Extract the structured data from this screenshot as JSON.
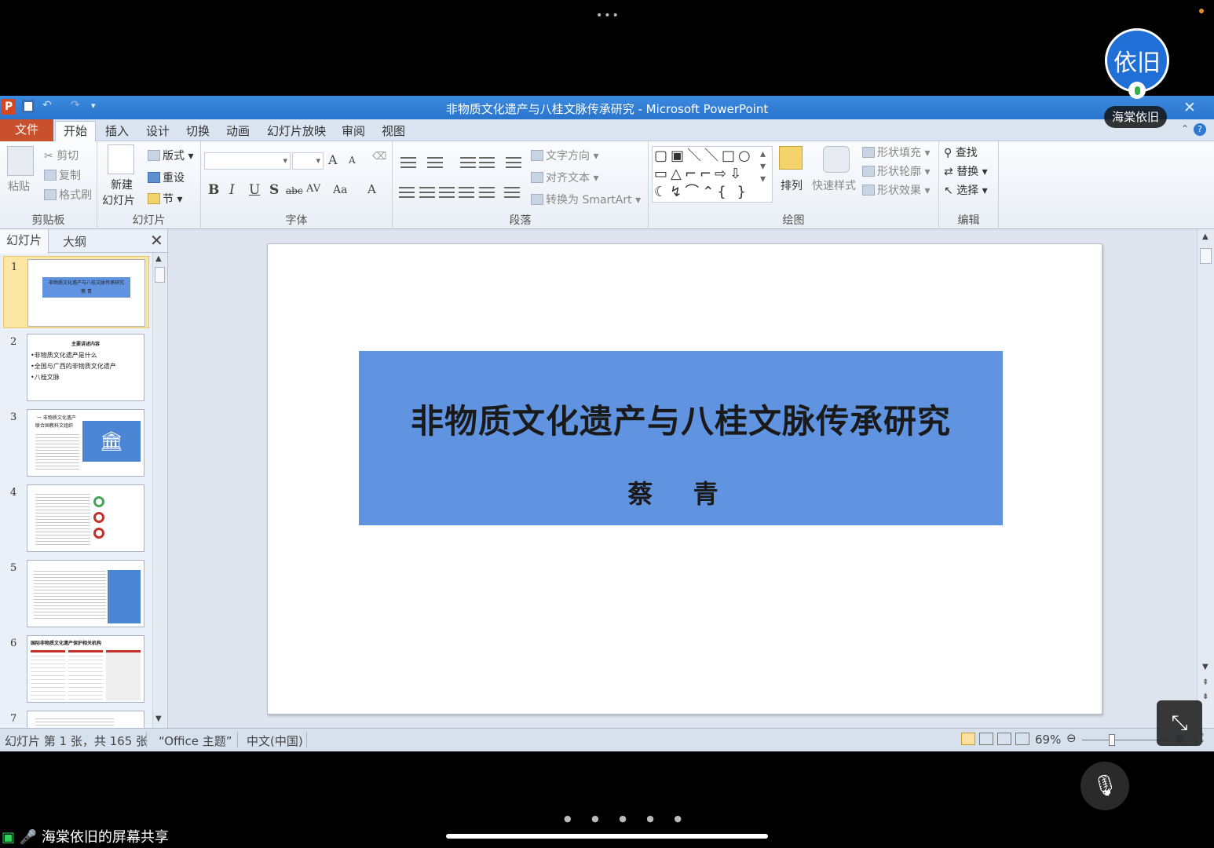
{
  "overlay": {
    "top_dots": "•••",
    "avatar_text": "依旧",
    "avatar_name": "海棠依旧",
    "share_text": "海棠依旧的屏幕共享",
    "page_dots": "● ● ● ● ●"
  },
  "window": {
    "app_logo": "P",
    "title": "非物质文化遗产与八桂文脉传承研究 - Microsoft PowerPoint",
    "close": "✕"
  },
  "tabs": {
    "file": "文件",
    "items": [
      "开始",
      "插入",
      "设计",
      "切换",
      "动画",
      "幻灯片放映",
      "审阅",
      "视图"
    ],
    "help": "?"
  },
  "ribbon": {
    "clipboard": {
      "label": "剪贴板",
      "paste": "粘贴",
      "cut": "剪切",
      "copy": "复制",
      "format_painter": "格式刷"
    },
    "slides": {
      "label": "幻灯片",
      "new_slide_1": "新建",
      "new_slide_2": "幻灯片",
      "layout": "版式",
      "reset": "重设",
      "section": "节"
    },
    "font": {
      "label": "字体",
      "bold": "B",
      "italic": "I",
      "underline": "U",
      "shadow": "S",
      "strike": "abc",
      "spacing": "AV",
      "case": "Aa",
      "color": "A",
      "grow": "A",
      "shrink": "A"
    },
    "paragraph": {
      "label": "段落",
      "text_direction": "文字方向",
      "align_text": "对齐文本",
      "smartart": "转换为 SmartArt"
    },
    "drawing": {
      "label": "绘图",
      "arrange": "排列",
      "quick_styles": "快速样式",
      "shape_fill": "形状填充",
      "shape_outline": "形状轮廓",
      "shape_effects": "形状效果",
      "shapes_glyphs": "▢▣＼＼□○\n▭△⌐⌐⇨⇩\n☾↯⌒⌃{ }"
    },
    "editing": {
      "label": "编辑",
      "find": "查找",
      "replace": "替换",
      "select": "选择"
    }
  },
  "panel": {
    "tab_slides": "幻灯片",
    "tab_outline": "大纲",
    "close": "✕",
    "thumbnails": [
      {
        "num": "1",
        "title": "非物质文化遗产与八桂文脉传承研究",
        "sub": "蔡 青"
      },
      {
        "num": "2",
        "title": "主要讲述内容",
        "lines": [
          "•非物质文化遗产是什么",
          "•全国与广西的非物质文化遗产",
          "•八桂文脉"
        ]
      },
      {
        "num": "3",
        "title": "一 非物质文化遗产",
        "sub": "联合国教科文组织"
      },
      {
        "num": "4"
      },
      {
        "num": "5"
      },
      {
        "num": "6",
        "title": "国际非物质文化遗产保护相关机构"
      },
      {
        "num": "7"
      }
    ]
  },
  "slide": {
    "title": "非物质文化遗产与八桂文脉传承研究",
    "author": "蔡 青"
  },
  "status": {
    "slide_info": "幻灯片 第 1 张，共 165 张",
    "theme": "“Office 主题”",
    "language": "中文(中国)",
    "zoom": "69%"
  }
}
